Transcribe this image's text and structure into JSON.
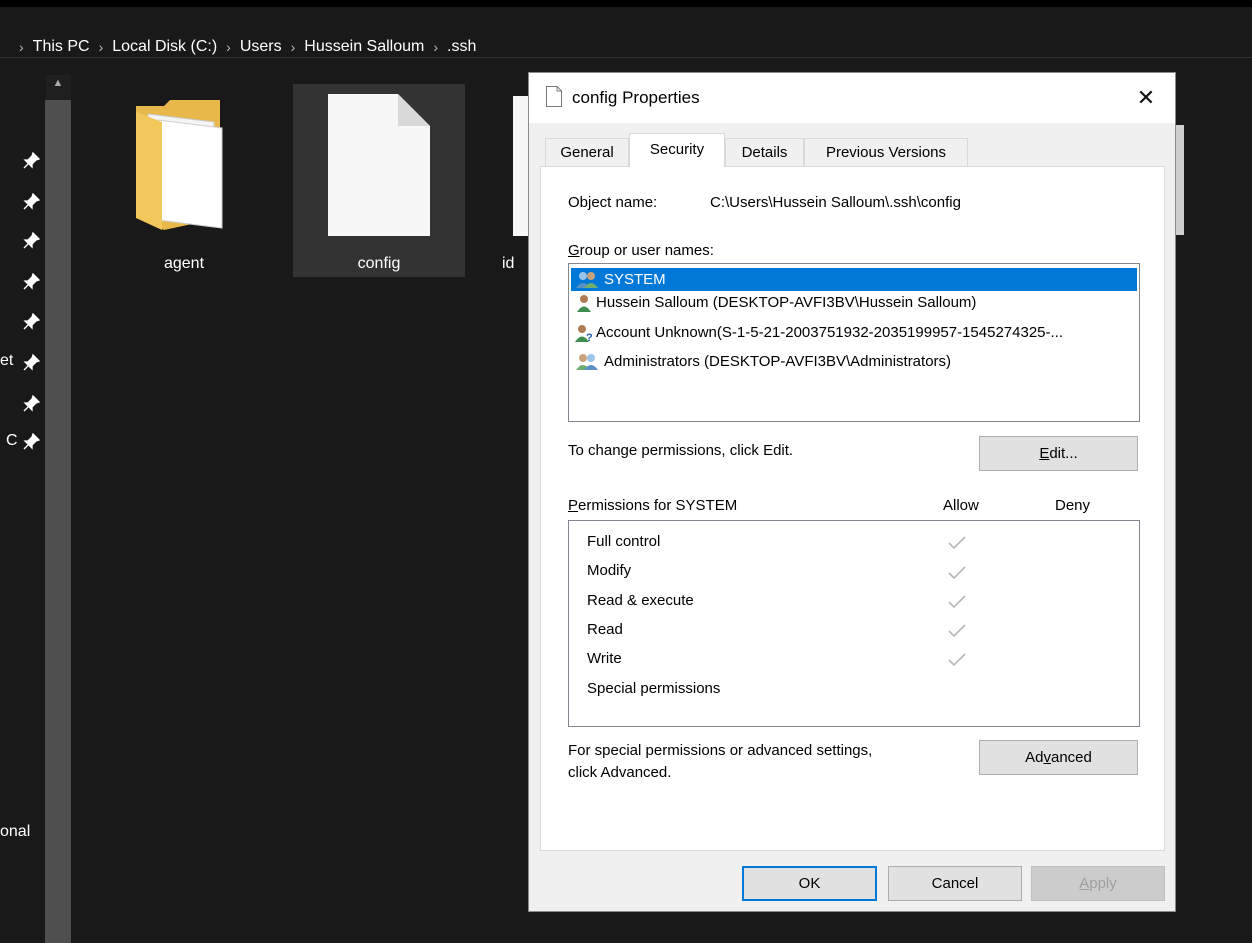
{
  "explorer": {
    "breadcrumb": [
      "This PC",
      "Local Disk (C:)",
      "Users",
      "Hussein Salloum",
      ".ssh"
    ],
    "files": [
      {
        "name": "agent",
        "type": "folder"
      },
      {
        "name": "config",
        "type": "file"
      },
      {
        "name": "id",
        "type": "file"
      }
    ],
    "nav_partial_labels": [
      "et",
      "C",
      "onal"
    ]
  },
  "dialog": {
    "title": "config Properties",
    "tabs": [
      "General",
      "Security",
      "Details",
      "Previous Versions"
    ],
    "active_tab": "Security",
    "object_name_label": "Object name:",
    "object_name_value": "C:\\Users\\Hussein Salloum\\.ssh\\config",
    "group_label_first": "G",
    "group_label_rest": "roup or user names:",
    "users": [
      {
        "name": "SYSTEM",
        "icon": "group-users-icon",
        "selected": true
      },
      {
        "name": "Hussein Salloum (DESKTOP-AVFI3BV\\Hussein Salloum)",
        "icon": "user-icon",
        "selected": false
      },
      {
        "name": "Account Unknown(S-1-5-21-2003751932-2035199957-1545274325-...",
        "icon": "unknown-user-icon",
        "selected": false
      },
      {
        "name": "Administrators (DESKTOP-AVFI3BV\\Administrators)",
        "icon": "group-users-icon",
        "selected": false
      }
    ],
    "change_perm_text": "To change permissions, click Edit.",
    "edit_button": {
      "underlined": "E",
      "rest": "dit..."
    },
    "permissions_label_first": "P",
    "permissions_label_rest": "ermissions for SYSTEM",
    "allow_header": "Allow",
    "deny_header": "Deny",
    "permissions": [
      {
        "name": "Full control",
        "allow": true,
        "deny": false
      },
      {
        "name": "Modify",
        "allow": true,
        "deny": false
      },
      {
        "name": "Read & execute",
        "allow": true,
        "deny": false
      },
      {
        "name": "Read",
        "allow": true,
        "deny": false
      },
      {
        "name": "Write",
        "allow": true,
        "deny": false
      },
      {
        "name": "Special permissions",
        "allow": false,
        "deny": false
      }
    ],
    "special_text_line1": "For special permissions or advanced settings,",
    "special_text_line2": "click Advanced.",
    "advanced_button": {
      "pre": "Ad",
      "underlined": "v",
      "post": "anced"
    },
    "ok_label": "OK",
    "cancel_label": "Cancel",
    "apply_button": {
      "underlined": "A",
      "rest": "pply"
    }
  },
  "colors": {
    "selection": "#0078d7",
    "explorer_bg": "#191919",
    "dialog_bg": "#f0f0f0"
  }
}
